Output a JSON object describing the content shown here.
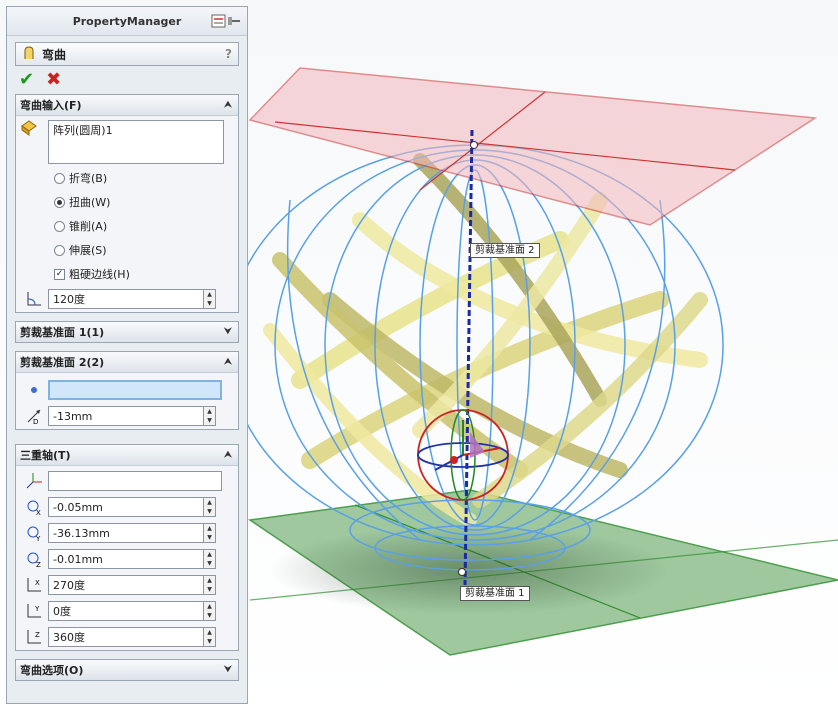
{
  "panel": {
    "title": "PropertyManager",
    "feature_title": "弯曲",
    "help": "?"
  },
  "bend_input": {
    "header": "弯曲输入(F)",
    "selection": "阵列(圆周)1",
    "options": [
      {
        "label": "折弯(B)",
        "selected": false
      },
      {
        "label": "扭曲(W)",
        "selected": true
      },
      {
        "label": "锥削(A)",
        "selected": false
      },
      {
        "label": "伸展(S)",
        "selected": false
      }
    ],
    "rough_edges": {
      "label": "粗硬边线(H)",
      "checked": true
    },
    "angle": "120度"
  },
  "trim_plane_1": {
    "header": "剪裁基准面 1(1)"
  },
  "trim_plane_2": {
    "header": "剪裁基准面 2(2)",
    "selection": "",
    "distance": "-13mm"
  },
  "triad": {
    "header": "三重轴(T)",
    "selection": "",
    "x_pos": "-0.05mm",
    "y_pos": "-36.13mm",
    "z_pos": "-0.01mm",
    "x_rot": "270度",
    "y_rot": "0度",
    "z_rot": "360度"
  },
  "bend_options": {
    "header": "弯曲选项(O)"
  },
  "viewport": {
    "label_top": "剪裁基准面 2",
    "label_bottom": "剪裁基准面 1"
  },
  "colors": {
    "accent_ok": "#1a9a1a",
    "accent_cancel": "#cc2222",
    "top_plane": "#f3b7bd",
    "bottom_plane": "#7fb27f",
    "ribbon": "#e6e38c",
    "wire": "#5aa0e6"
  },
  "icons": [
    "pushpin-icon",
    "bend-feature-icon",
    "check-icon",
    "close-icon",
    "chevron-up-icon",
    "chevron-down-icon",
    "selection-icon",
    "angle-icon",
    "distance-icon",
    "triad-icon",
    "position-x-icon",
    "position-y-icon",
    "position-z-icon",
    "rotation-x-icon",
    "rotation-y-icon",
    "rotation-z-icon"
  ]
}
